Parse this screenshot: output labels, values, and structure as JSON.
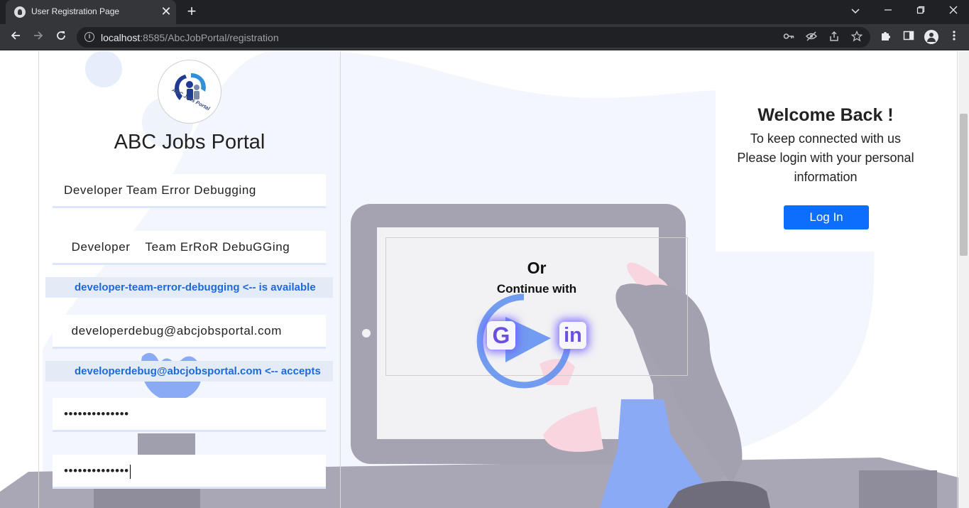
{
  "browser": {
    "tab_title": "User Registration Page",
    "url_host": "localhost",
    "url_rest": ":8585/AbcJobPortal/registration",
    "tab_close_glyph": "✕",
    "new_tab_glyph": "+",
    "icons": [
      "info-icon",
      "key-icon",
      "eye-off-icon",
      "share-icon",
      "star-icon",
      "extensions-icon",
      "side-panel-icon",
      "profile-icon"
    ]
  },
  "logo": {
    "text": "ABC Jobs Portal"
  },
  "brand": {
    "title": "ABC Jobs Portal"
  },
  "form": {
    "full_name": "Developer Team Error Debugging",
    "display_name": "  Developer    Team ErRoR DebuGGing",
    "username_note": "developer-team-error-debugging <-- is available",
    "email": "  developerdebug@abcjobsportal.com",
    "email_note": "developerdebug@abcjobsportal.com <-- accepts",
    "password": "••••••••••••••",
    "confirm_password": "••••••••••••••"
  },
  "welcome": {
    "title": "Welcome Back !",
    "line1": "To keep connected with us",
    "line2": "Please login with your personal",
    "line3": "information",
    "login_label": "Log In"
  },
  "social": {
    "or": "Or",
    "continue_with": "Continue with",
    "google_label": "G",
    "linkedin_label": "in"
  },
  "colors": {
    "accent": "#0d6efd",
    "note_text": "#1c6ad9",
    "note_bg": "#e3ebf7",
    "social_glow": "#6e5aff"
  }
}
